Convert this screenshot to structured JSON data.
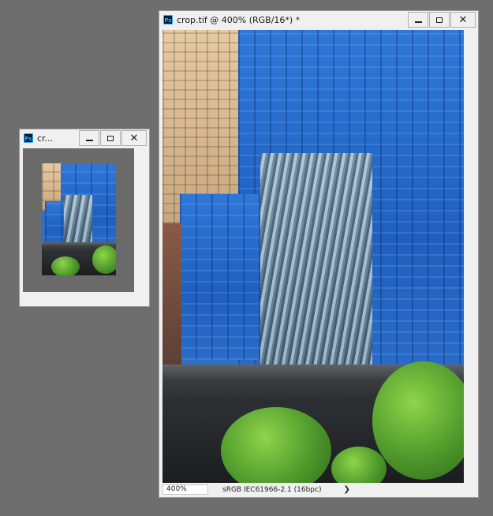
{
  "small_window": {
    "title": "cr...",
    "icon": "ps-icon"
  },
  "main_window": {
    "title": "crop.tif @ 400% (RGB/16*) *",
    "icon": "ps-icon",
    "status": {
      "zoom": "400%",
      "profile": "sRGB IEC61966-2.1 (16bpc)",
      "arrow": "❯"
    }
  },
  "controls": {
    "close_glyph": "✕"
  }
}
